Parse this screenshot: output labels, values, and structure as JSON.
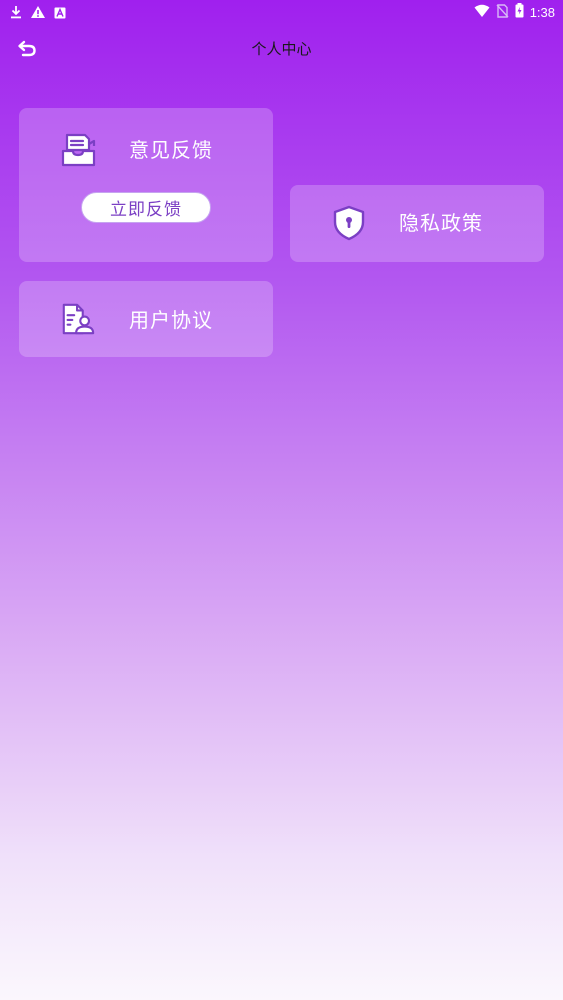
{
  "status_bar": {
    "time": "1:38",
    "icons": [
      "download-icon",
      "warning-icon",
      "a-icon",
      "wifi-icon",
      "no-sim-icon",
      "battery-charging-icon"
    ]
  },
  "header": {
    "title": "个人中心",
    "back_icon": "back-arrow-icon"
  },
  "cards": {
    "feedback": {
      "label": "意见反馈",
      "button_label": "立即反馈",
      "icon": "feedback-icon"
    },
    "privacy": {
      "label": "隐私政策",
      "icon": "shield-lock-icon"
    },
    "agreement": {
      "label": "用户协议",
      "icon": "user-document-icon"
    }
  },
  "colors": {
    "gradient_top": "#a020ee",
    "gradient_bottom": "#fbf7fd",
    "icon_purple": "#7b3fc4",
    "card_text": "#ffffff"
  }
}
